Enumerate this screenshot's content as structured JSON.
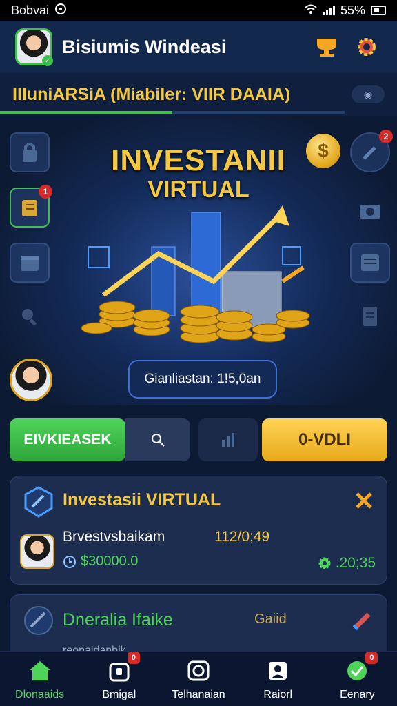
{
  "status_bar": {
    "carrier": "Bobvai",
    "battery": "55%"
  },
  "header": {
    "title": "Bisiumis Windeasi"
  },
  "ticker": {
    "text": "IIIuniARSiA (Miabiler: VIIR DAAIA)",
    "progress": 0.5
  },
  "hero": {
    "title_line1": "INVESTANII",
    "title_line2": "VIRTUAL",
    "balance_label": "Gianliastan: 1!5,0an",
    "left_badge": "1",
    "right_badge": "2"
  },
  "actions": {
    "green_button": "EIVKIEASEK",
    "gold_button": "0-VDLI"
  },
  "cards": [
    {
      "title": "Investasii VIRTUAL",
      "name": "Brvestvsbaikam",
      "date": "112/0;49",
      "amount": "$30000.0",
      "rate": ".20;35"
    },
    {
      "title": "Dneralia Ifaike",
      "right_text": "Gaiid",
      "subtext": "reonaidanbik"
    }
  ],
  "bottom_nav": [
    {
      "label": "Dlonaaids",
      "icon": "home-icon",
      "badge": ""
    },
    {
      "label": "Bmigal",
      "icon": "bag-icon",
      "badge": "0"
    },
    {
      "label": "Telhanaian",
      "icon": "camera-icon",
      "badge": ""
    },
    {
      "label": "Raiorl",
      "icon": "profile-icon",
      "badge": ""
    },
    {
      "label": "Eenary",
      "icon": "check-icon",
      "badge": "0"
    }
  ],
  "colors": {
    "accent_gold": "#f5c842",
    "accent_green": "#4fd45a",
    "background": "#0d1a33",
    "badge_red": "#d42a2a"
  }
}
